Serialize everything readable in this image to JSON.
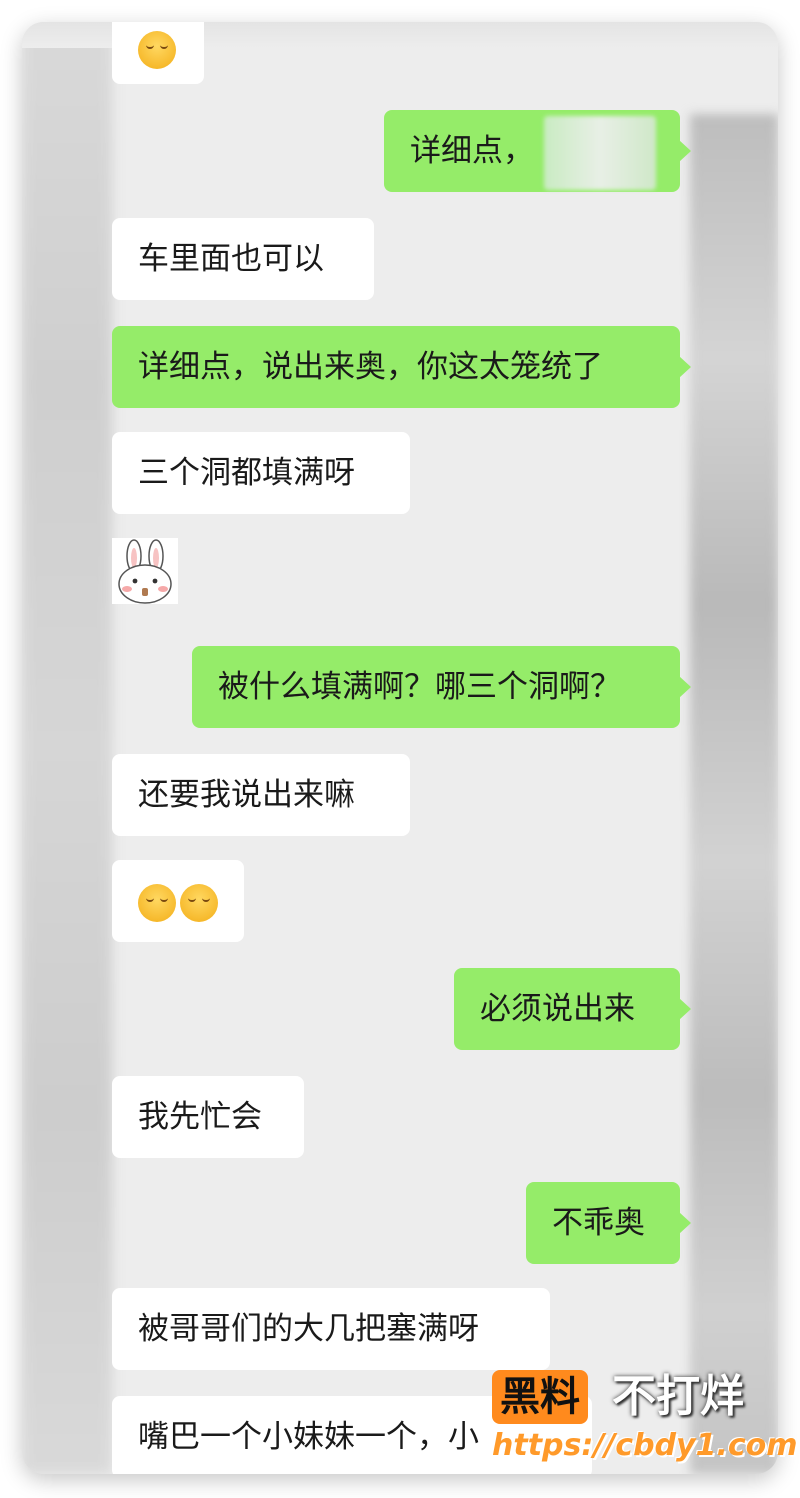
{
  "messages": [
    {
      "side": "in",
      "text": "车里面也可以"
    },
    {
      "side": "out",
      "text": "详细点，说出来奥，你这太笼统了"
    },
    {
      "side": "in",
      "text": "三个洞都填满呀"
    },
    {
      "side": "out",
      "text": "被什么填满啊？哪三个洞啊？"
    },
    {
      "side": "in",
      "text": "还要我说出来嘛"
    },
    {
      "side": "out",
      "text": "必须说出来"
    },
    {
      "side": "in",
      "text": "我先忙会"
    },
    {
      "side": "out",
      "text": "不乖奥"
    },
    {
      "side": "in",
      "text": "被哥哥们的大几把塞满呀"
    },
    {
      "side": "in",
      "text": "嘴巴一个小妹妹一个，小"
    }
  ],
  "first_out": {
    "text": "详细点，"
  },
  "emoji_message": {
    "icon": "smirk-emoji-icon",
    "count": 2
  },
  "sticker": {
    "icon": "bunny-sticker-icon"
  },
  "watermark": {
    "badge": "黑料",
    "tail": "不打烊",
    "url": "https://cbdy1.com"
  },
  "colors": {
    "chat_bg": "#ededed",
    "outgoing_bubble": "#95ec69",
    "incoming_bubble": "#ffffff",
    "watermark_orange": "#ff8a1d"
  }
}
